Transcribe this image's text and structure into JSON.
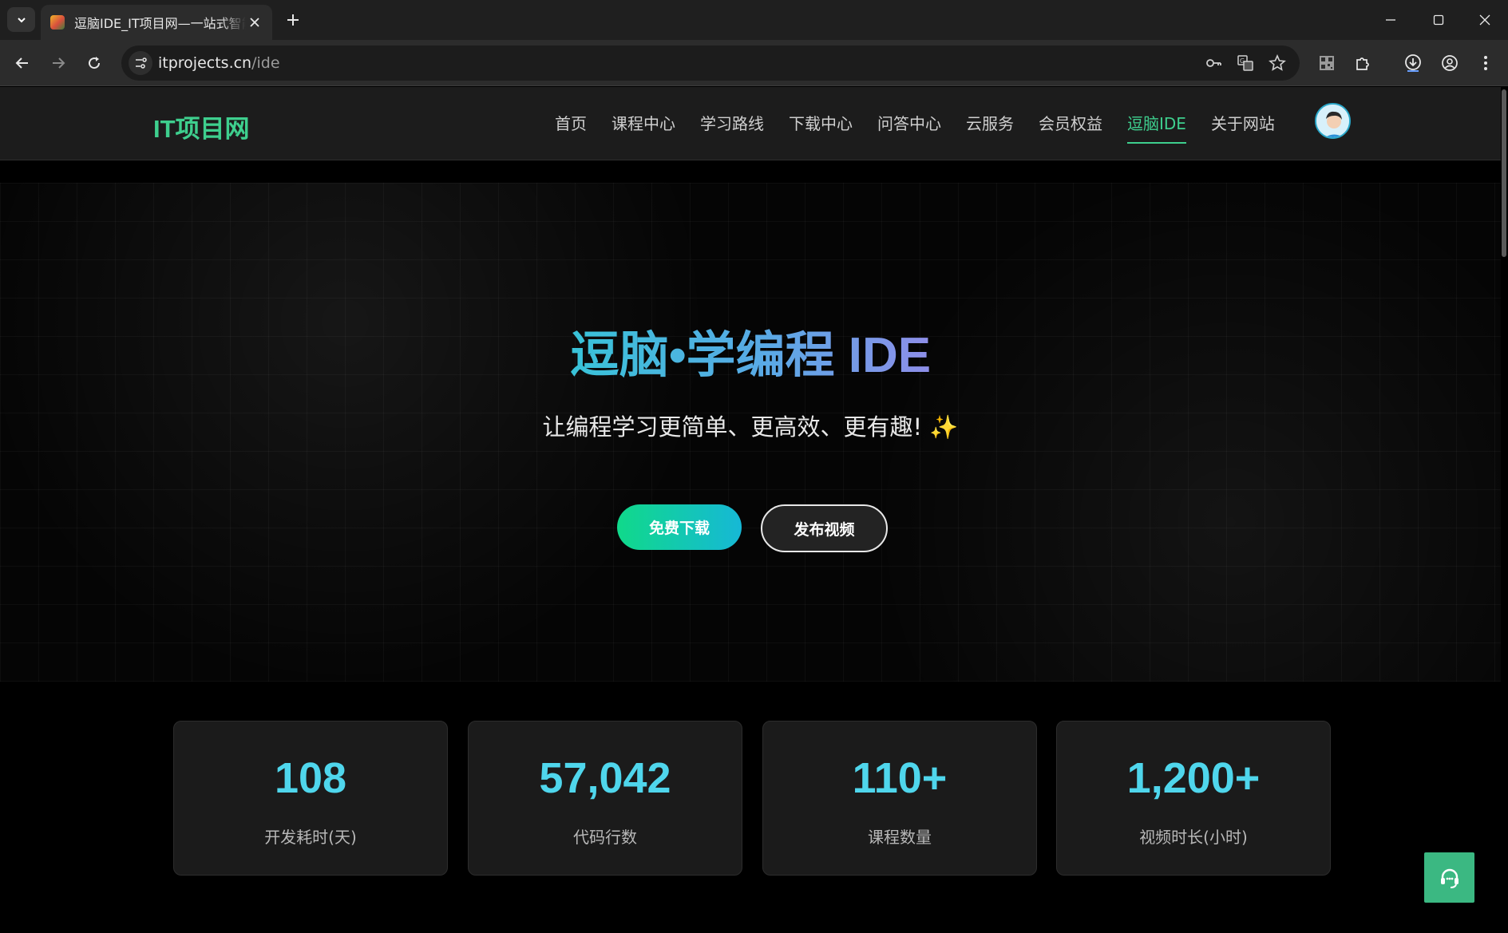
{
  "browser": {
    "tab_title": "逗脑IDE_IT项目网—一站式智能",
    "url_host": "itprojects.cn",
    "url_path": "/ide"
  },
  "site": {
    "logo": "IT项目网",
    "nav": [
      {
        "label": "首页",
        "active": false
      },
      {
        "label": "课程中心",
        "active": false
      },
      {
        "label": "学习路线",
        "active": false
      },
      {
        "label": "下载中心",
        "active": false
      },
      {
        "label": "问答中心",
        "active": false
      },
      {
        "label": "云服务",
        "active": false
      },
      {
        "label": "会员权益",
        "active": false
      },
      {
        "label": "逗脑IDE",
        "active": true
      },
      {
        "label": "关于网站",
        "active": false
      }
    ]
  },
  "hero": {
    "title": "逗脑•学编程 IDE",
    "subtitle": "让编程学习更简单、更高效、更有趣! ✨",
    "primary_button": "免费下载",
    "secondary_button": "发布视频"
  },
  "stats": [
    {
      "value": "108",
      "label": "开发耗时(天)"
    },
    {
      "value": "57,042",
      "label": "代码行数"
    },
    {
      "value": "110+",
      "label": "课程数量"
    },
    {
      "value": "1,200+",
      "label": "视频时长(小时)"
    }
  ],
  "colors": {
    "brand_green": "#3ecf8e",
    "stat_cyan": "#4fd6ec",
    "support_green": "#3bb882"
  }
}
